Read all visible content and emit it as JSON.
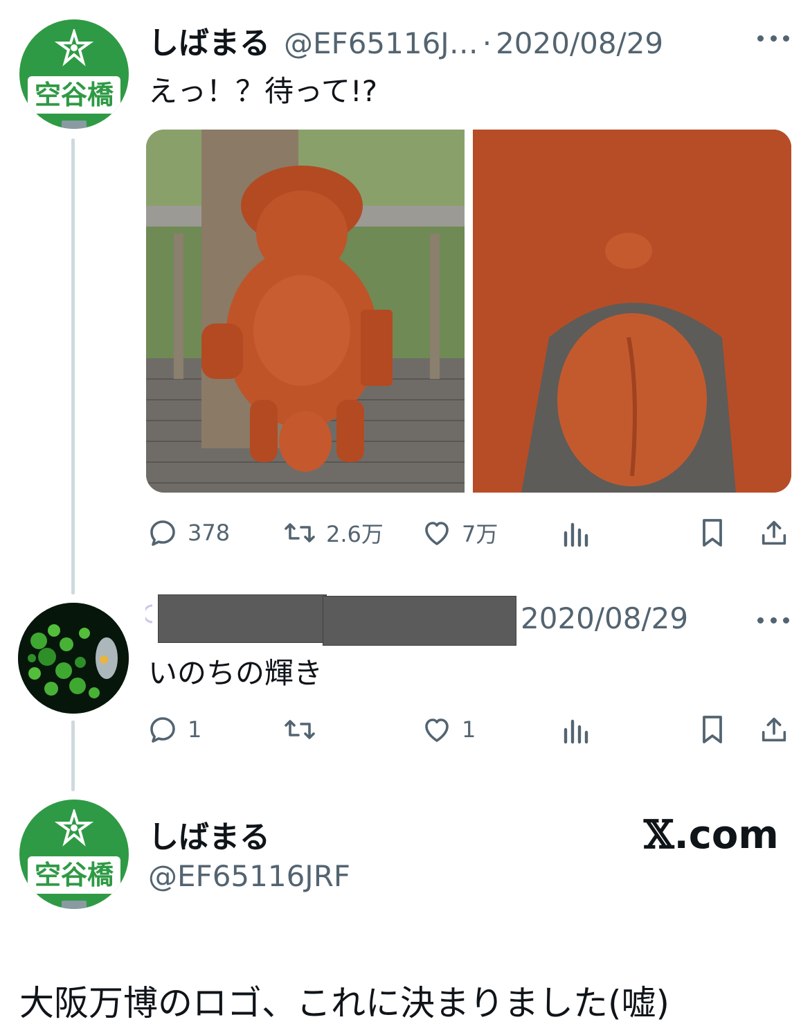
{
  "tweet1": {
    "display_name": "しばまる",
    "handle": "@EF65116J…",
    "separator": "·",
    "date": "2020/08/29",
    "text": "えっ！？待って!?",
    "media_alt": [
      "tanuki-statue-photo",
      "tanuki-statue-closeup-photo"
    ],
    "actions": {
      "reply_count": "378",
      "retweet_count": "2.6万",
      "like_count": "7万"
    }
  },
  "reply": {
    "date": "2020/08/29",
    "text": "いのちの輝き",
    "actions": {
      "reply_count": "1",
      "like_count": "1"
    }
  },
  "card": {
    "display_name": "しばまる",
    "handle": "@EF65116JRF",
    "site_logo": "𝕏",
    "site_domain": ".com"
  },
  "avatar_station_name": "空谷橋",
  "caption": "大阪万博のロゴ、これに決まりました(嘘)",
  "colors": {
    "station_green": "#2f9a45",
    "terracotta": "#b5502a",
    "secondary_text": "#536471",
    "thread_line": "#cfd9de"
  }
}
